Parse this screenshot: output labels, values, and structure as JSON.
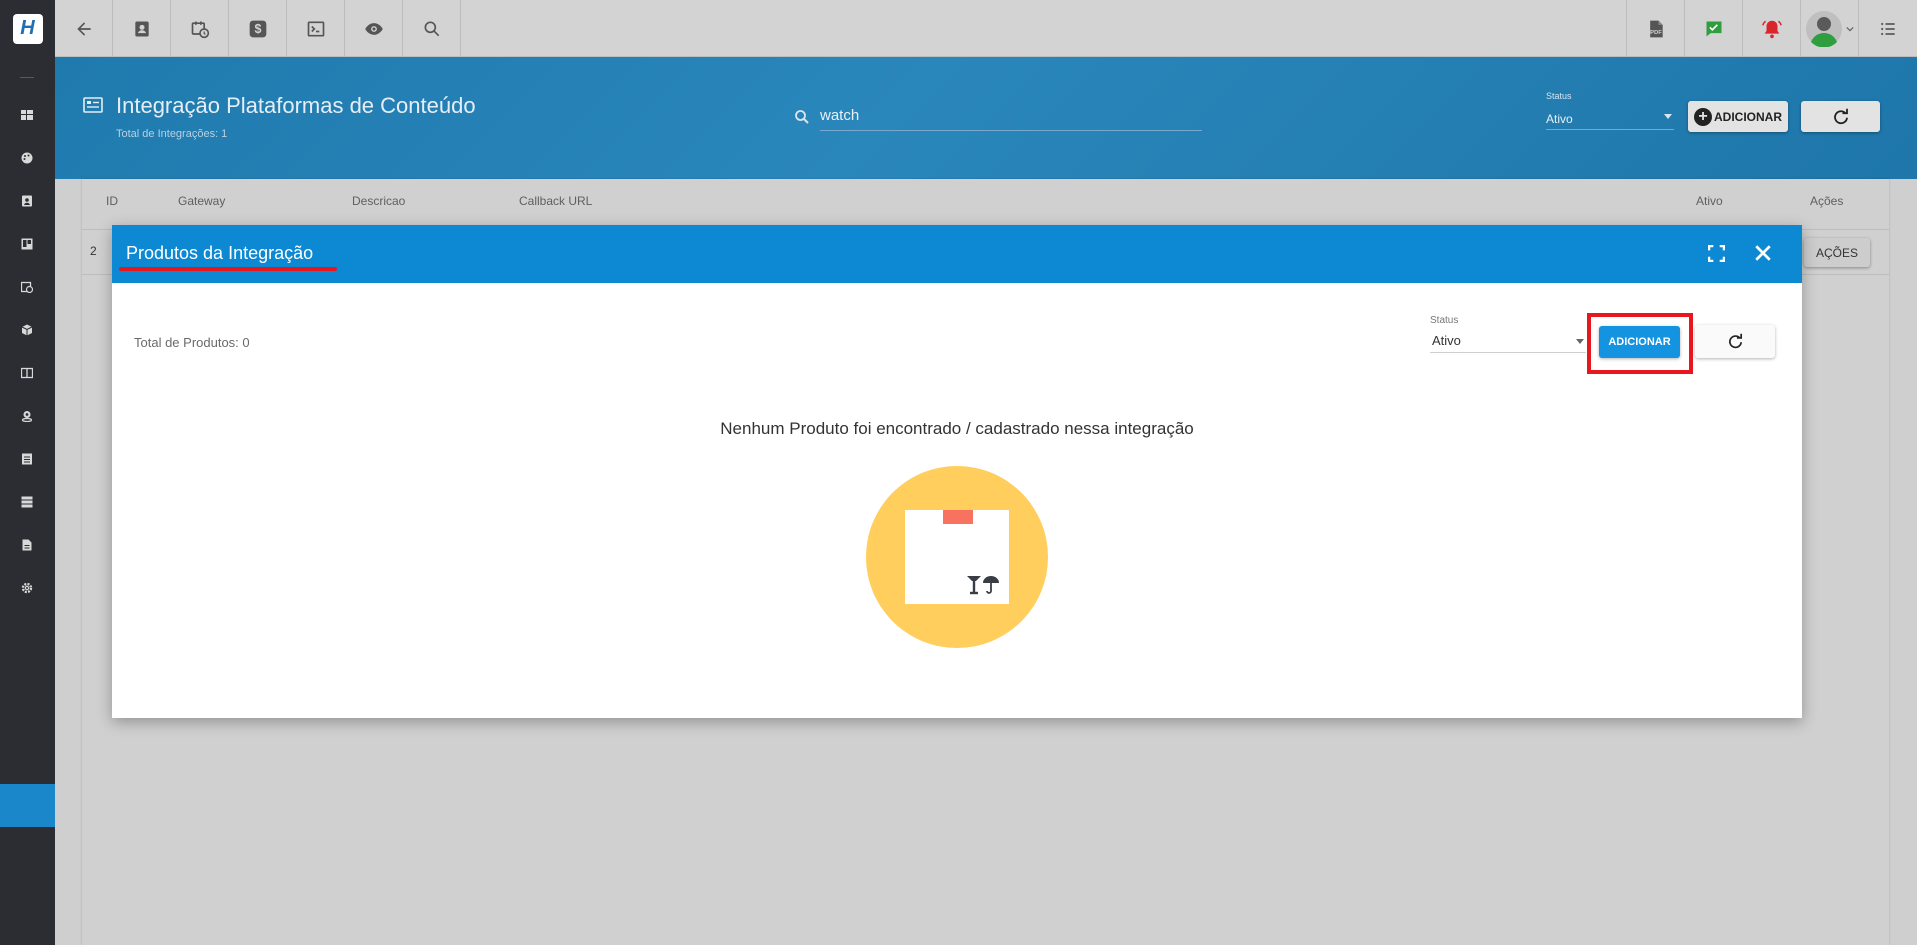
{
  "topbar": {
    "logo_letter": "H",
    "nav_icons": [
      "back-arrow-icon",
      "contact-card-icon",
      "calendar-clock-icon",
      "dollar-icon",
      "terminal-icon",
      "eye-icon",
      "search-icon"
    ],
    "right_icons": [
      "pdf-icon",
      "check-message-icon",
      "alarm-bell-icon",
      "user-avatar",
      "list-menu-icon"
    ],
    "colors": {
      "bar": "#d3d3d3",
      "check_green": "#2e9e3e",
      "bell_red": "#d9262b"
    }
  },
  "sidebar": {
    "icons": [
      "dashboard-icon",
      "palette-icon",
      "contact-icon",
      "board-icon",
      "calendar-icon",
      "package-icon",
      "book-icon",
      "location-icon",
      "document-list-icon",
      "storage-icon",
      "file-icon",
      "settings-icon"
    ],
    "active_color": "#1987c9"
  },
  "header": {
    "title": "Integração Plataformas de Conteúdo",
    "subtitle": "Total de Integrações: 1",
    "search_value": "watch",
    "status_label": "Status",
    "status_value": "Ativo",
    "add_label": "ADICIONAR"
  },
  "table": {
    "columns": [
      "ID",
      "Gateway",
      "Descricao",
      "Callback URL",
      "Ativo",
      "Ações"
    ],
    "rows": [
      {
        "id": "2",
        "actions_label": "AÇÕES"
      }
    ]
  },
  "modal": {
    "title": "Produtos da Integração",
    "total_label": "Total de Produtos: 0",
    "status_label": "Status",
    "status_value": "Ativo",
    "add_label": "ADICIONAR",
    "empty_message": "Nenhum Produto foi encontrado / cadastrado nessa integração",
    "colors": {
      "header": "#0d89d4",
      "add_button": "#1493e0",
      "highlight": "#e8161d",
      "illustration_circle": "#ffce5c",
      "box_tape": "#f7735f"
    }
  }
}
